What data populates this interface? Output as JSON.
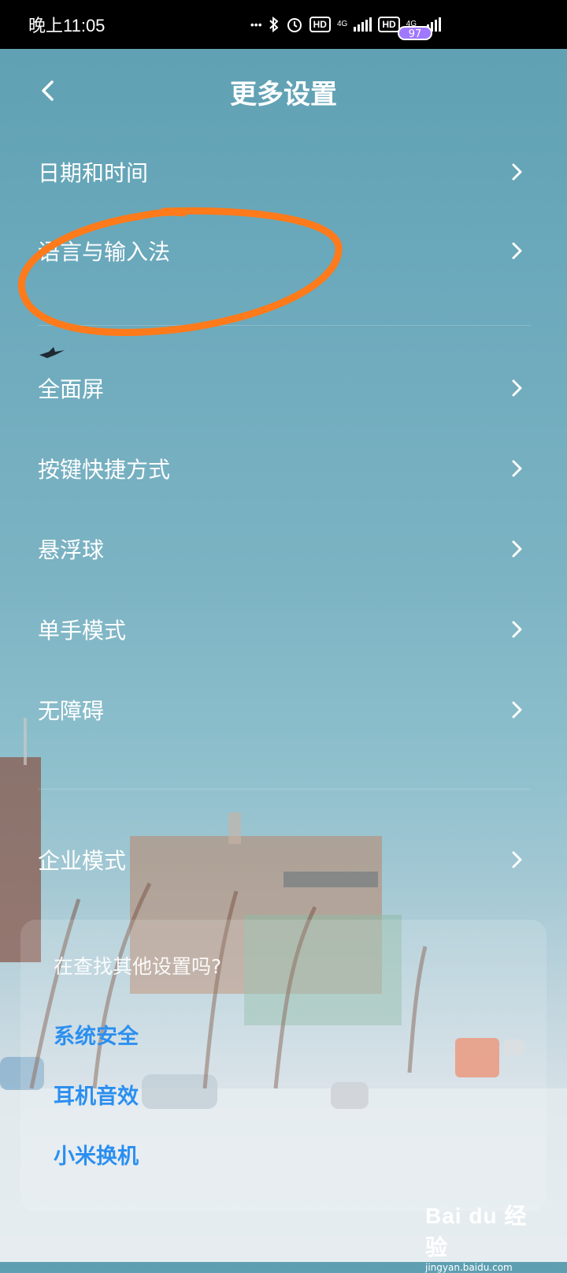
{
  "status_bar": {
    "time": "晚上11:05",
    "dots": "•••",
    "hd1": "HD",
    "net1": "4G",
    "hd2": "HD",
    "net2": "4G",
    "battery": "97",
    "icons": [
      "bluetooth-icon",
      "alarm-icon",
      "signal-icon",
      "battery-icon"
    ]
  },
  "header": {
    "title": "更多设置",
    "back_icon": "chevron-left-icon"
  },
  "menu": {
    "items": [
      {
        "label": "日期和时间"
      },
      {
        "label": "语言与输入法"
      },
      {
        "label": "全面屏"
      },
      {
        "label": "按键快捷方式"
      },
      {
        "label": "悬浮球"
      },
      {
        "label": "单手模式"
      },
      {
        "label": "无障碍"
      },
      {
        "label": "企业模式"
      }
    ]
  },
  "suggest": {
    "question": "在查找其他设置吗?",
    "links": [
      "系统安全",
      "耳机音效",
      "小米换机"
    ]
  },
  "watermark": {
    "logo": "Bai du 经验",
    "url": "jingyan.baidu.com"
  },
  "colors": {
    "link": "#2b8ff0",
    "annotation": "#ff7a1a",
    "battery": "#a077ff"
  }
}
